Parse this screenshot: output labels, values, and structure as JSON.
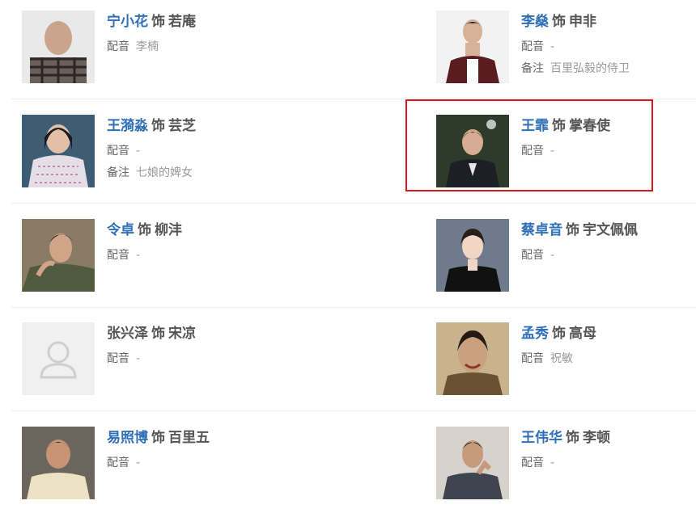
{
  "connector": "饰",
  "labels": {
    "dub": "配音",
    "note": "备注"
  },
  "cast": [
    {
      "actor": "宁小花",
      "role": "若庵",
      "dub": "李楠",
      "note": null,
      "linked": true,
      "photo": "bald-man-plaid-shirt"
    },
    {
      "actor": "李燊",
      "role": "申非",
      "dub": "-",
      "note": "百里弘毅的侍卫",
      "linked": true,
      "photo": "young-man-dark-jacket"
    },
    {
      "actor": "王漪淼",
      "role": "芸芝",
      "dub": "-",
      "note": "七娘的婢女",
      "linked": true,
      "photo": "woman-knit-sweater"
    },
    {
      "actor": "王霏",
      "role": "掌春使",
      "dub": "-",
      "note": null,
      "linked": true,
      "photo": "man-suit-outdoor"
    },
    {
      "actor": "令卓",
      "role": "柳沣",
      "dub": "-",
      "note": null,
      "linked": true,
      "photo": "man-leaning-portrait"
    },
    {
      "actor": "蔡卓音",
      "role": "宇文佩佩",
      "dub": "-",
      "note": null,
      "linked": true,
      "photo": "woman-black-dress"
    },
    {
      "actor": "张兴泽",
      "role": "宋凉",
      "dub": "-",
      "note": null,
      "linked": false,
      "photo": "placeholder-avatar"
    },
    {
      "actor": "孟秀",
      "role": "高母",
      "dub": "祝敏",
      "note": null,
      "linked": true,
      "photo": "smiling-woman"
    },
    {
      "actor": "易照博",
      "role": "百里五",
      "dub": "-",
      "note": null,
      "linked": true,
      "photo": "man-cream-shirt"
    },
    {
      "actor": "王伟华",
      "role": "李顿",
      "dub": "-",
      "note": null,
      "linked": true,
      "photo": "man-hand-on-chin"
    }
  ],
  "colors": {
    "link": "#2f6fb7",
    "highlight": "#d9161d",
    "text": "#555555",
    "muted": "#999999"
  }
}
